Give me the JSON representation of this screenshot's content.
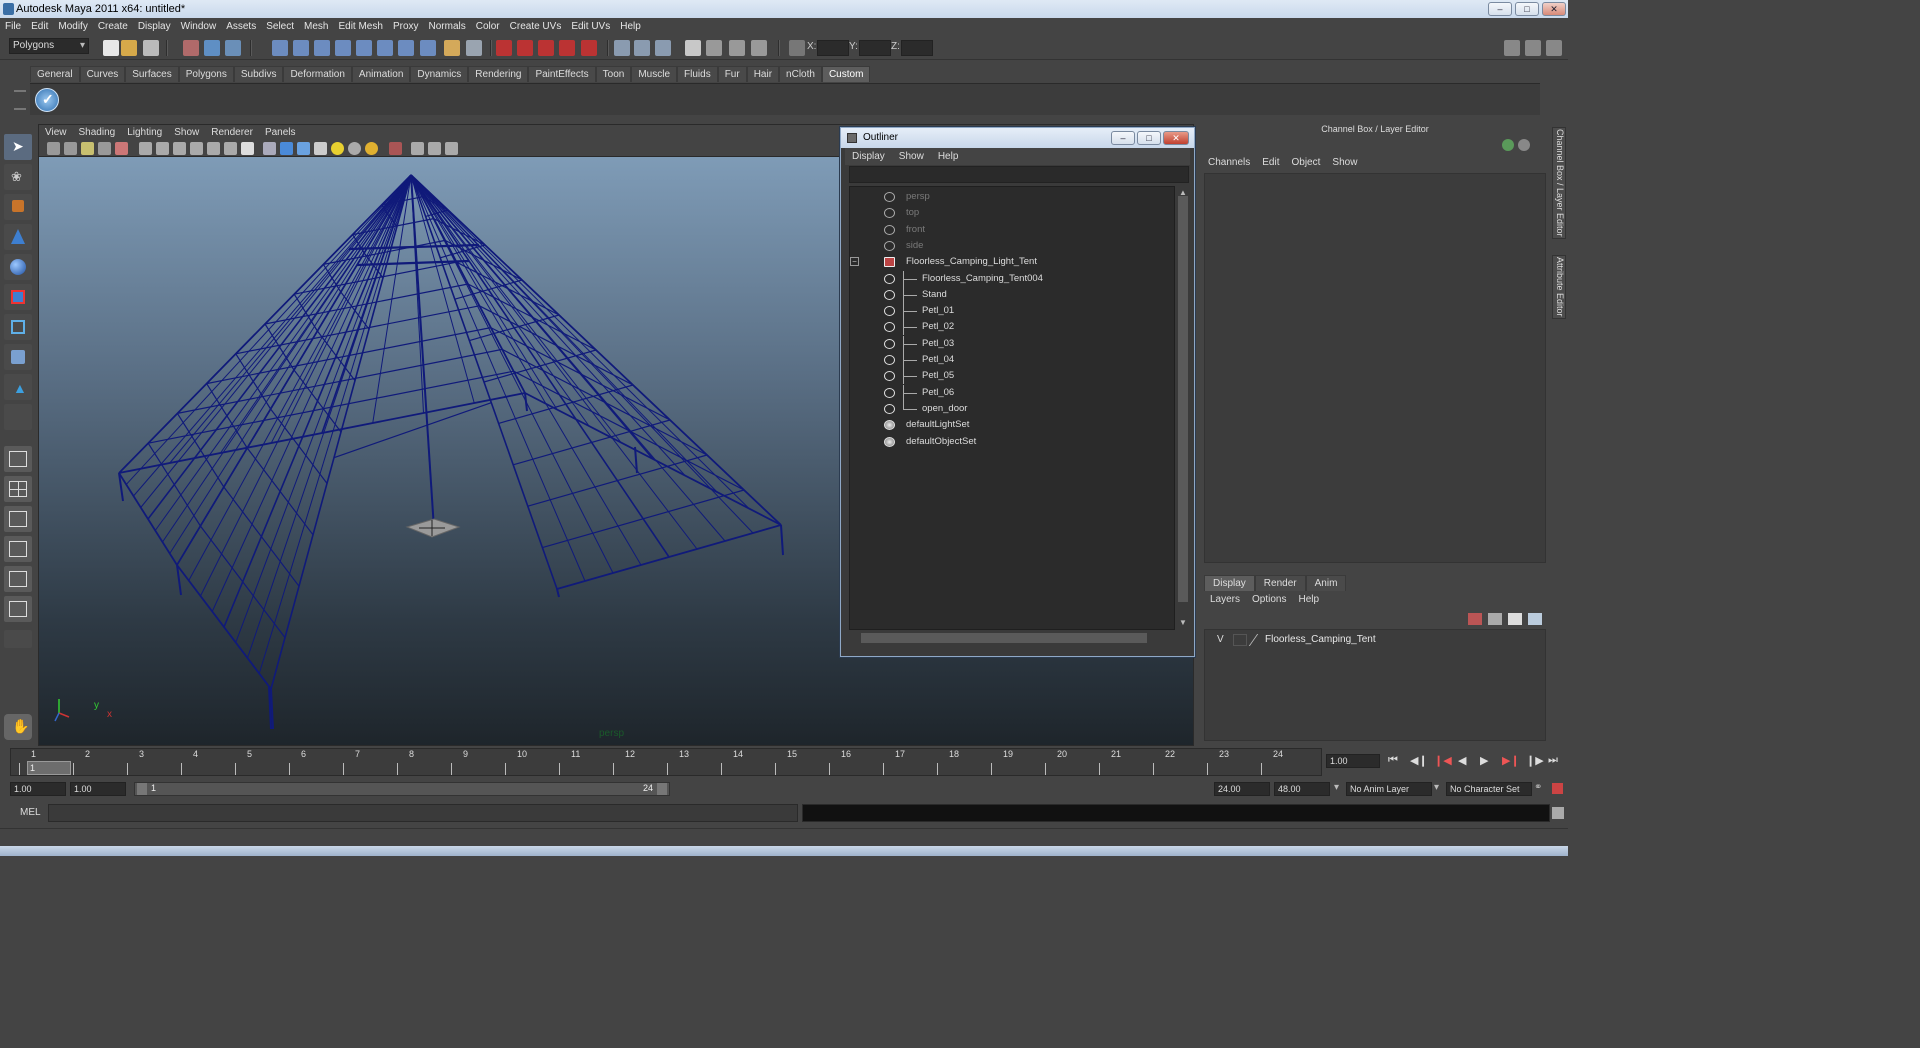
{
  "window": {
    "title": "Autodesk Maya 2011 x64: untitled*"
  },
  "menubar": [
    "File",
    "Edit",
    "Modify",
    "Create",
    "Display",
    "Window",
    "Assets",
    "Select",
    "Mesh",
    "Edit Mesh",
    "Proxy",
    "Normals",
    "Color",
    "Create UVs",
    "Edit UVs",
    "Help"
  ],
  "statusline": {
    "mode": "Polygons",
    "x_label": "X:",
    "y_label": "Y:",
    "z_label": "Z:"
  },
  "shelf_tabs": [
    "General",
    "Curves",
    "Surfaces",
    "Polygons",
    "Subdivs",
    "Deformation",
    "Animation",
    "Dynamics",
    "Rendering",
    "PaintEffects",
    "Toon",
    "Muscle",
    "Fluids",
    "Fur",
    "Hair",
    "nCloth",
    "Custom"
  ],
  "shelf_active": "Custom",
  "viewport": {
    "menu": [
      "View",
      "Shading",
      "Lighting",
      "Show",
      "Renderer",
      "Panels"
    ],
    "camera_label": "persp",
    "axis_x": "x",
    "axis_y": "y"
  },
  "outliner": {
    "title": "Outliner",
    "menu": [
      "Display",
      "Show",
      "Help"
    ],
    "items": [
      {
        "label": "persp",
        "dim": true
      },
      {
        "label": "top",
        "dim": true
      },
      {
        "label": "front",
        "dim": true
      },
      {
        "label": "side",
        "dim": true
      },
      {
        "label": "Floorless_Camping_Light_Tent",
        "dim": false
      },
      {
        "label": "Floorless_Camping_Tent004",
        "dim": false
      },
      {
        "label": "Stand",
        "dim": false
      },
      {
        "label": "Petl_01",
        "dim": false
      },
      {
        "label": "Petl_02",
        "dim": false
      },
      {
        "label": "Petl_03",
        "dim": false
      },
      {
        "label": "Petl_04",
        "dim": false
      },
      {
        "label": "Petl_05",
        "dim": false
      },
      {
        "label": "Petl_06",
        "dim": false
      },
      {
        "label": "open_door",
        "dim": false
      },
      {
        "label": "defaultLightSet",
        "dim": false
      },
      {
        "label": "defaultObjectSet",
        "dim": false
      }
    ]
  },
  "channelbox": {
    "header": "Channel Box / Layer Editor",
    "menu": [
      "Channels",
      "Edit",
      "Object",
      "Show"
    ],
    "layer_tabs": [
      "Display",
      "Render",
      "Anim"
    ],
    "layer_menu": [
      "Layers",
      "Options",
      "Help"
    ],
    "layer": {
      "visible": "V",
      "name": "Floorless_Camping_Tent"
    },
    "side_tabs": [
      "Channel Box / Layer Editor",
      "Attribute Editor"
    ]
  },
  "timeline": {
    "ticks": [
      "1",
      "2",
      "3",
      "4",
      "5",
      "6",
      "7",
      "8",
      "9",
      "10",
      "11",
      "12",
      "13",
      "14",
      "15",
      "16",
      "17",
      "18",
      "19",
      "20",
      "21",
      "22",
      "23",
      "24"
    ],
    "current_frame_marker": "1",
    "current_time": "1.00"
  },
  "range": {
    "start": "1.00",
    "playback_start": "1.00",
    "slider_start": "1",
    "slider_end": "24",
    "playback_end": "24.00",
    "end": "48.00",
    "anim_layer": "No Anim Layer",
    "character_set": "No Character Set"
  },
  "command": {
    "label": "MEL"
  },
  "colors": {
    "wireframe": "#101a7a",
    "viewport_top": "#84a2be",
    "viewport_bottom": "#1e252b",
    "panel_bg": "#444444"
  }
}
